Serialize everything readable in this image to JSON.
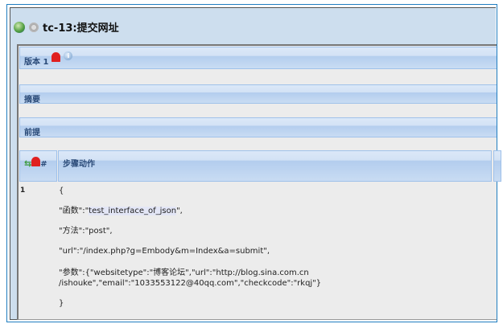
{
  "title": "tc-13:提交网址",
  "sections": {
    "version": "版本 1",
    "summary": "摘要",
    "precondition": "前提"
  },
  "table": {
    "hash_header": "#",
    "step_header": "步骤动作",
    "rows": [
      {
        "number": "1",
        "lines": [
          "{",
          "\"函数\":\"",
          "test_interface_of_json",
          "\",",
          "\"方法\":\"post\",",
          "\"url\":\"/index.php?g=Embody&m=Index&a=submit\",",
          "\"参数\":{\"websitetype\":\"博客论坛\",\"url\":\"http://blog.sina.com.cn",
          "/ishouke\",\"email\":\"1033553122@40qq.com\",\"checkcode\":\"rkqj\"}",
          "}"
        ]
      }
    ]
  }
}
